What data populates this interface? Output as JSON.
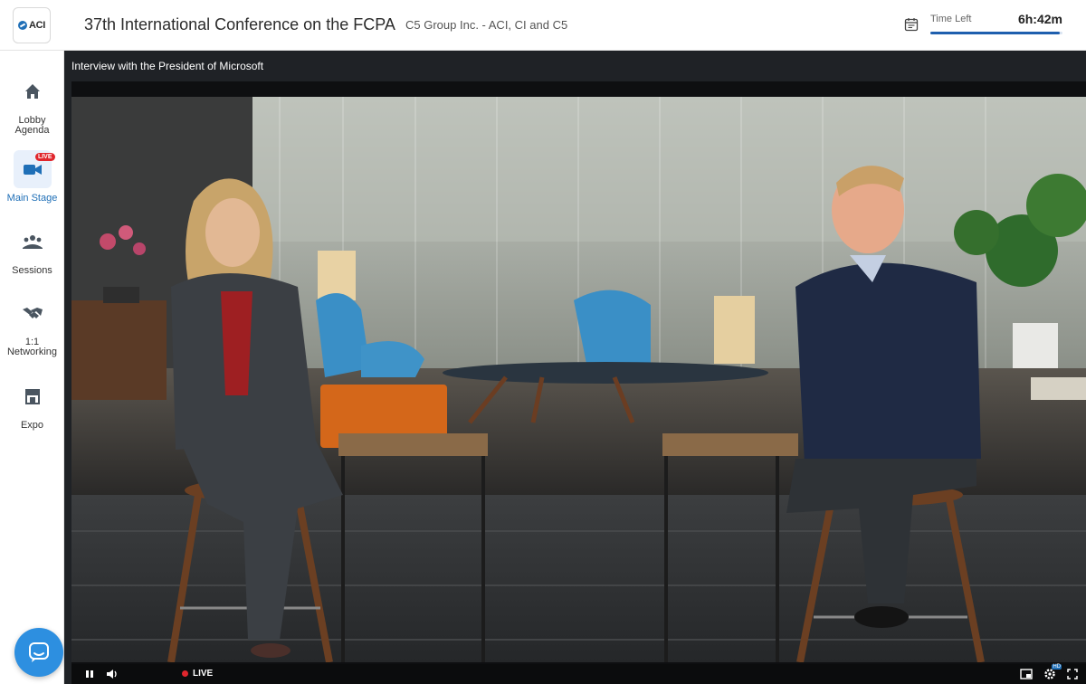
{
  "header": {
    "logo_text": "ACI",
    "event_title": "37th International Conference on the FCPA",
    "organizer": "C5 Group Inc. - ACI, CI and C5",
    "time_left_label": "Time Left",
    "time_left_value": "6h:42m",
    "time_left_progress": 0.98
  },
  "sidebar": {
    "items": [
      {
        "label": "Lobby\nAgenda",
        "icon": "home-icon"
      },
      {
        "label": "Main Stage",
        "icon": "video-camera-icon",
        "badge": "LIVE",
        "active": true
      },
      {
        "label": "Sessions",
        "icon": "group-icon"
      },
      {
        "label": "1:1\nNetworking",
        "icon": "handshake-icon"
      },
      {
        "label": "Expo",
        "icon": "storefront-icon"
      }
    ],
    "chat_icon": "chat-bubble-icon"
  },
  "stage": {
    "session_title": "Interview with the President of Microsoft",
    "player": {
      "live_label": "LIVE",
      "controls": [
        "pause-icon",
        "volume-icon",
        "picture-in-picture-icon",
        "settings-icon",
        "fullscreen-icon"
      ],
      "settings_badge": "HD"
    }
  },
  "colors": {
    "accent": "#1f6fb7",
    "live": "#e0262d",
    "stage_bg": "#1f2226",
    "chat": "#2d8fe0"
  }
}
